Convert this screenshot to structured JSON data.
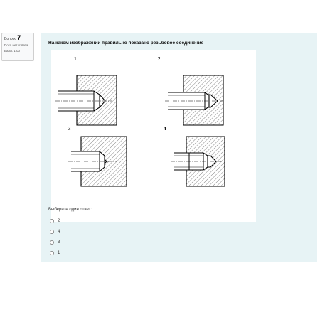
{
  "info": {
    "question_prefix": "Вопрос",
    "question_number": "7",
    "state": "Пока нет ответа",
    "grade": "Балл: 1,00"
  },
  "question": {
    "text": "На каком изображении правильно показано резьбовое соединение",
    "figure_labels": [
      "1",
      "2",
      "3",
      "4"
    ],
    "prompt": "Выберите один ответ:",
    "options": [
      {
        "label": "2",
        "selected": false
      },
      {
        "label": "4",
        "selected": false
      },
      {
        "label": "3",
        "selected": false
      },
      {
        "label": "1",
        "selected": false
      }
    ]
  },
  "colors": {
    "content_bg": "#e7f3f5",
    "info_bg": "#f8f9fa"
  }
}
